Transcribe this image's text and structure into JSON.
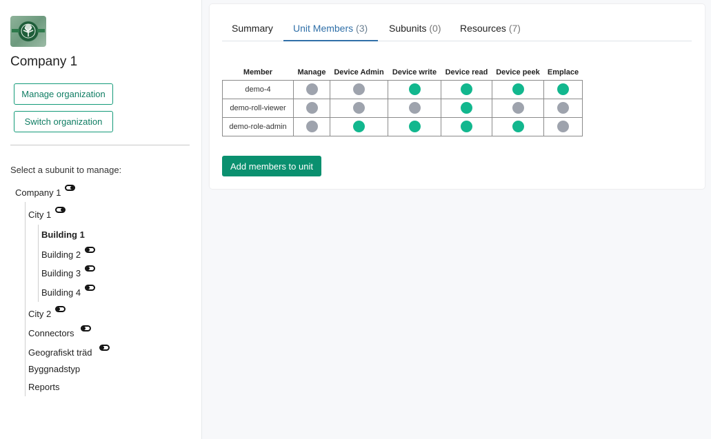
{
  "sidebar": {
    "logo_icon": "tree-logo-icon",
    "org_name": "Company 1",
    "manage_org_label": "Manage organization",
    "switch_org_label": "Switch organization",
    "subunit_prompt": "Select a subunit to manage:",
    "tree": [
      {
        "label": "Company 1",
        "level": 0,
        "toggle": "on",
        "bold": false
      },
      {
        "label": "City 1",
        "level": 1,
        "toggle": "on",
        "bold": false
      },
      {
        "label": "Building 1",
        "level": 2,
        "toggle": null,
        "bold": true
      },
      {
        "label": "Building 2",
        "level": 2,
        "toggle": "off",
        "bold": false
      },
      {
        "label": "Building 3",
        "level": 2,
        "toggle": "off",
        "bold": false
      },
      {
        "label": "Building 4",
        "level": 2,
        "toggle": "off",
        "bold": false
      },
      {
        "label": "City 2",
        "level": 1,
        "toggle": "off",
        "bold": false
      },
      {
        "label": "Connectors",
        "level": 1,
        "toggle": "off",
        "bold": false
      },
      {
        "label": "Geografiskt träd",
        "level": 1,
        "toggle": "off",
        "bold": false
      },
      {
        "label": "Byggnadstyp",
        "level": 1,
        "toggle": null,
        "bold": false
      },
      {
        "label": "Reports",
        "level": 1,
        "toggle": null,
        "bold": false
      }
    ]
  },
  "tabs": [
    {
      "label": "Summary",
      "count": "",
      "active": false
    },
    {
      "label": "Unit Members",
      "count": "(3)",
      "active": true
    },
    {
      "label": "Subunits",
      "count": "(0)",
      "active": false
    },
    {
      "label": "Resources",
      "count": "(7)",
      "active": false
    }
  ],
  "members_table": {
    "columns": [
      "Member",
      "Manage",
      "Device Admin",
      "Device write",
      "Device read",
      "Device peek",
      "Emplace"
    ],
    "rows": [
      {
        "member": "demo-4",
        "permissions": [
          false,
          false,
          true,
          true,
          true,
          true
        ]
      },
      {
        "member": "demo-roll-viewer",
        "permissions": [
          false,
          false,
          false,
          true,
          false,
          false
        ]
      },
      {
        "member": "demo-role-admin",
        "permissions": [
          false,
          true,
          true,
          true,
          true,
          false
        ]
      }
    ]
  },
  "add_members_label": "Add members to unit",
  "colors": {
    "permission_on": "#12b78e",
    "permission_off": "#9ea3ad",
    "accent_green": "#0a906f",
    "active_tab": "#2f6fa8"
  }
}
